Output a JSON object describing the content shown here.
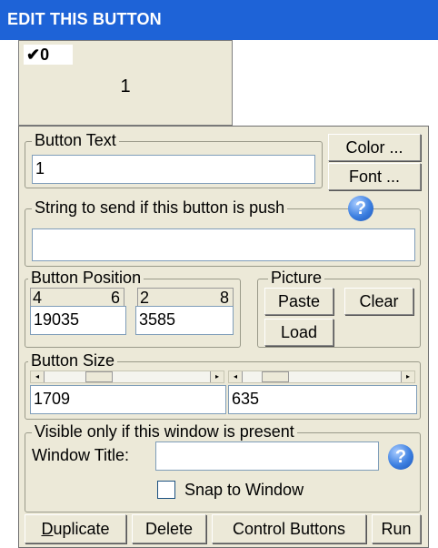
{
  "window": {
    "title": "EDIT THIS BUTTON"
  },
  "preview": {
    "checkbox_mark": "✔",
    "checkbox_value": "0",
    "button_text": "1"
  },
  "button_text_group": {
    "legend": "Button Text",
    "value": "1",
    "color_label": "Color ...",
    "font_label": "Font ..."
  },
  "string_group": {
    "legend": "String to send if this button is push",
    "value": "",
    "help": "?"
  },
  "position_group": {
    "legend": "Button Position",
    "x_from": "4",
    "x_to": "6",
    "y_from": "2",
    "y_to": "8",
    "x_value": "19035",
    "y_value": "3585"
  },
  "picture_group": {
    "legend": "Picture",
    "paste_label": "Paste",
    "clear_label": "Clear",
    "load_label": "Load"
  },
  "size_group": {
    "legend": "Button Size",
    "width_value": "1709",
    "height_value": "635",
    "left_arrow": "◂",
    "right_arrow": "▸"
  },
  "visible_group": {
    "legend": "Visible only if this window is present",
    "window_title_label": "Window Title:",
    "window_title_value": "",
    "help": "?",
    "snap_label": "Snap to Window",
    "snap_checked": false
  },
  "footer": {
    "duplicate_mnemonic": "D",
    "duplicate_rest": "uplicate",
    "delete_label": "Delete",
    "control_buttons_label": "Control Buttons",
    "run_label": "Run"
  },
  "colors": {
    "title_bar": "#1e63d7",
    "panel": "#ece9d8",
    "help_icon": "#3c7fe0"
  }
}
